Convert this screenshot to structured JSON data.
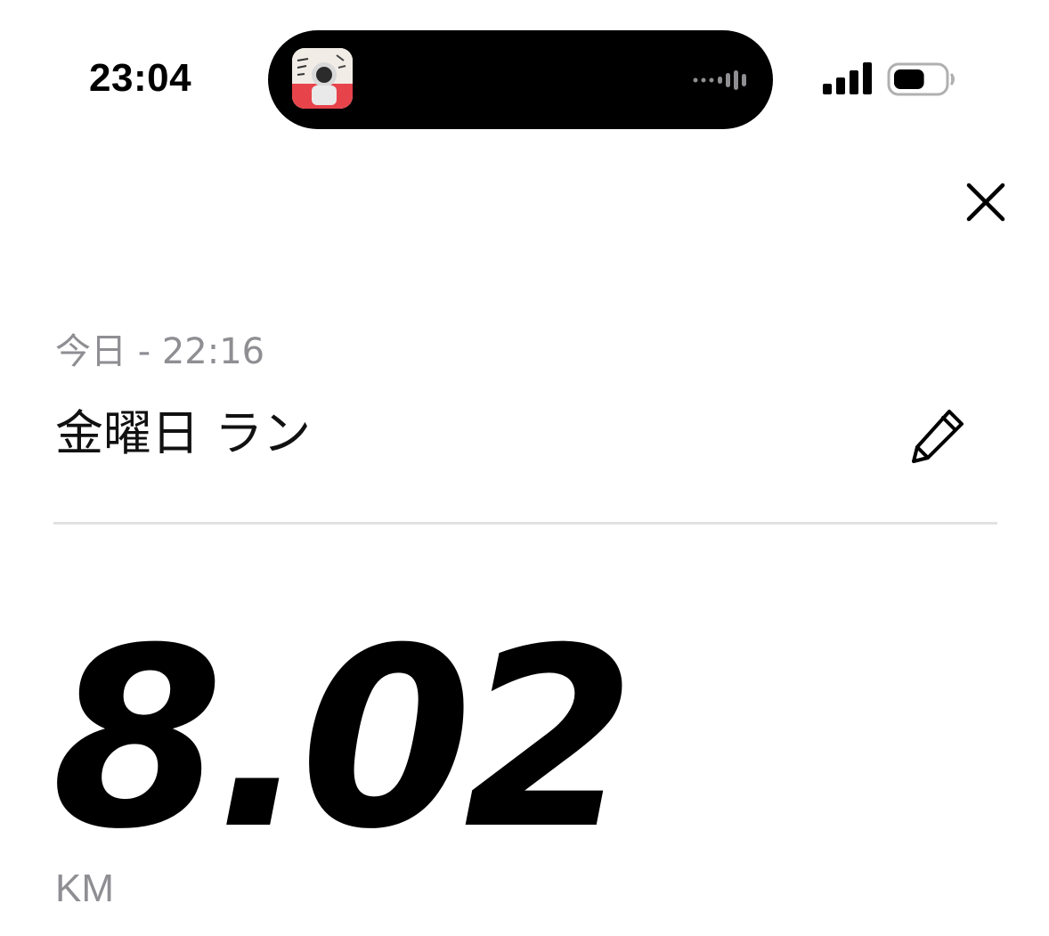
{
  "status_bar": {
    "time": "23:04",
    "now_playing_icon": "album-art",
    "audio_icon": "waveform-icon",
    "signal_icon": "cellular-signal-icon",
    "battery_icon": "battery-icon",
    "battery_level": 0.6
  },
  "header": {
    "close_icon": "close-icon",
    "date_time": "今日 - 22:16",
    "title": "金曜日 ラン",
    "edit_icon": "pencil-icon"
  },
  "summary": {
    "distance": "8.02",
    "unit": "KM"
  },
  "colors": {
    "text_primary": "#000000",
    "text_secondary": "#8e8e93",
    "divider": "#e2e2e2",
    "island": "#000000"
  }
}
